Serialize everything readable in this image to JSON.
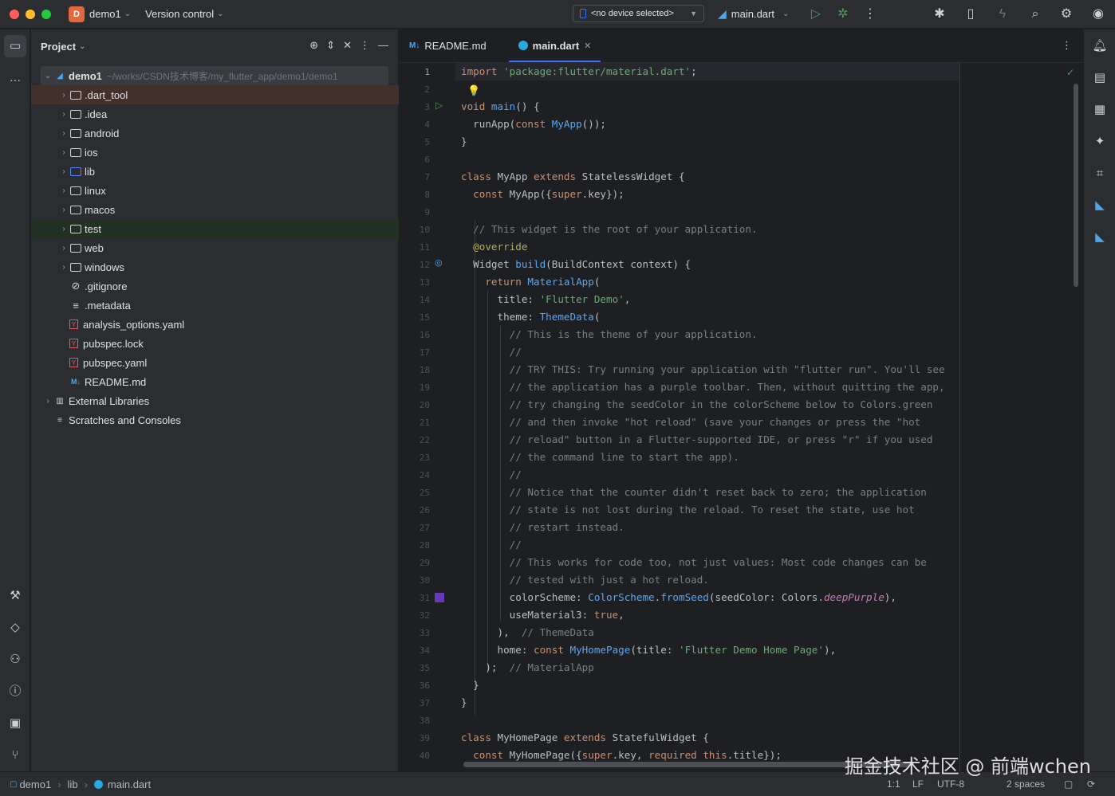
{
  "titlebar": {
    "project_badge": "D",
    "project_name": "demo1",
    "vcs": "Version control",
    "device": "<no device selected>",
    "run_config": "main.dart"
  },
  "project_panel": {
    "title": "Project",
    "root": {
      "name": "demo1",
      "path": "~/works/CSDN技术博客/my_flutter_app/demo1/demo1"
    },
    "items": [
      {
        "name": ".dart_tool",
        "kind": "folder",
        "expandable": true
      },
      {
        "name": ".idea",
        "kind": "folder",
        "expandable": true
      },
      {
        "name": "android",
        "kind": "folder",
        "expandable": true
      },
      {
        "name": "ios",
        "kind": "folder",
        "expandable": true
      },
      {
        "name": "lib",
        "kind": "folder",
        "expandable": true
      },
      {
        "name": "linux",
        "kind": "folder",
        "expandable": true
      },
      {
        "name": "macos",
        "kind": "folder",
        "expandable": true
      },
      {
        "name": "test",
        "kind": "folder",
        "expandable": true
      },
      {
        "name": "web",
        "kind": "folder",
        "expandable": true
      },
      {
        "name": "windows",
        "kind": "folder",
        "expandable": true
      },
      {
        "name": ".gitignore",
        "kind": "file",
        "expandable": false
      },
      {
        "name": ".metadata",
        "kind": "file",
        "expandable": false
      },
      {
        "name": "analysis_options.yaml",
        "kind": "yaml",
        "expandable": false
      },
      {
        "name": "pubspec.lock",
        "kind": "yaml",
        "expandable": false
      },
      {
        "name": "pubspec.yaml",
        "kind": "yaml",
        "expandable": false
      },
      {
        "name": "README.md",
        "kind": "md",
        "expandable": false
      }
    ],
    "external_libraries": "External Libraries",
    "scratches": "Scratches and Consoles"
  },
  "tabs": [
    {
      "label": "README.md",
      "icon": "M↓",
      "active": false
    },
    {
      "label": "main.dart",
      "icon": "dart",
      "active": true
    }
  ],
  "code_lines": [
    [
      [
        "kw",
        "import "
      ],
      [
        "str",
        "'package:flutter/material.dart'"
      ],
      [
        "df",
        ";"
      ]
    ],
    [],
    [
      [
        "kw",
        "void "
      ],
      [
        "fn",
        "main"
      ],
      [
        "df",
        "() {"
      ]
    ],
    [
      [
        "df",
        "  runApp("
      ],
      [
        "kw",
        "const "
      ],
      [
        "cls",
        "MyApp"
      ],
      [
        "df",
        "());"
      ]
    ],
    [
      [
        "df",
        "}"
      ]
    ],
    [],
    [
      [
        "kw",
        "class "
      ],
      [
        "df",
        "MyApp "
      ],
      [
        "kw",
        "extends "
      ],
      [
        "df",
        "StatelessWidget {"
      ]
    ],
    [
      [
        "df",
        "  "
      ],
      [
        "kw",
        "const "
      ],
      [
        "df",
        "MyApp({"
      ],
      [
        "kw",
        "super"
      ],
      [
        "df",
        ".key});"
      ]
    ],
    [],
    [
      [
        "cm",
        "  // This widget is the root of your application."
      ]
    ],
    [
      [
        "ann",
        "  @override"
      ]
    ],
    [
      [
        "df",
        "  Widget "
      ],
      [
        "fn",
        "build"
      ],
      [
        "df",
        "(BuildContext context) {"
      ]
    ],
    [
      [
        "kw",
        "    return "
      ],
      [
        "cls",
        "MaterialApp"
      ],
      [
        "df",
        "("
      ]
    ],
    [
      [
        "df",
        "      title: "
      ],
      [
        "str",
        "'Flutter Demo'"
      ],
      [
        "df",
        ","
      ]
    ],
    [
      [
        "df",
        "      theme: "
      ],
      [
        "cls",
        "ThemeData"
      ],
      [
        "df",
        "("
      ]
    ],
    [
      [
        "cm",
        "        // This is the theme of your application."
      ]
    ],
    [
      [
        "cm",
        "        //"
      ]
    ],
    [
      [
        "cm",
        "        // TRY THIS: Try running your application with \"flutter run\". You'll see"
      ]
    ],
    [
      [
        "cm",
        "        // the application has a purple toolbar. Then, without quitting the app,"
      ]
    ],
    [
      [
        "cm",
        "        // try changing the seedColor in the colorScheme below to Colors.green"
      ]
    ],
    [
      [
        "cm",
        "        // and then invoke \"hot reload\" (save your changes or press the \"hot"
      ]
    ],
    [
      [
        "cm",
        "        // reload\" button in a Flutter-supported IDE, or press \"r\" if you used"
      ]
    ],
    [
      [
        "cm",
        "        // the command line to start the app)."
      ]
    ],
    [
      [
        "cm",
        "        //"
      ]
    ],
    [
      [
        "cm",
        "        // Notice that the counter didn't reset back to zero; the application"
      ]
    ],
    [
      [
        "cm",
        "        // state is not lost during the reload. To reset the state, use hot"
      ]
    ],
    [
      [
        "cm",
        "        // restart instead."
      ]
    ],
    [
      [
        "cm",
        "        //"
      ]
    ],
    [
      [
        "cm",
        "        // This works for code too, not just values: Most code changes can be"
      ]
    ],
    [
      [
        "cm",
        "        // tested with just a hot reload."
      ]
    ],
    [
      [
        "df",
        "        colorScheme: "
      ],
      [
        "cls",
        "ColorScheme"
      ],
      [
        "df",
        "."
      ],
      [
        "fn",
        "fromSeed"
      ],
      [
        "df",
        "(seedColor: Colors."
      ],
      [
        "it",
        "deepPurple"
      ],
      [
        "df",
        "),"
      ]
    ],
    [
      [
        "df",
        "        useMaterial3: "
      ],
      [
        "kw",
        "true"
      ],
      [
        "df",
        ","
      ]
    ],
    [
      [
        "df",
        "      ),  "
      ],
      [
        "cm",
        "// ThemeData"
      ]
    ],
    [
      [
        "df",
        "      home: "
      ],
      [
        "kw",
        "const "
      ],
      [
        "cls",
        "MyHomePage"
      ],
      [
        "df",
        "(title: "
      ],
      [
        "str",
        "'Flutter Demo Home Page'"
      ],
      [
        "df",
        "),"
      ]
    ],
    [
      [
        "df",
        "    );  "
      ],
      [
        "cm",
        "// MaterialApp"
      ]
    ],
    [
      [
        "df",
        "  }"
      ]
    ],
    [
      [
        "df",
        "}"
      ]
    ],
    [],
    [
      [
        "kw",
        "class "
      ],
      [
        "df",
        "MyHomePage "
      ],
      [
        "kw",
        "extends "
      ],
      [
        "df",
        "StatefulWidget {"
      ]
    ],
    [
      [
        "df",
        "  "
      ],
      [
        "kw",
        "const "
      ],
      [
        "df",
        "MyHomePage({"
      ],
      [
        "kw",
        "super"
      ],
      [
        "df",
        ".key, "
      ],
      [
        "kw",
        "required this"
      ],
      [
        "df",
        ".title});"
      ]
    ]
  ],
  "status": {
    "crumb_project": "demo1",
    "crumb_folder": "lib",
    "crumb_file": "main.dart",
    "position": "1:1",
    "line_sep": "LF",
    "encoding": "UTF-8",
    "indent": "2 spaces"
  },
  "watermark": "掘金技术社区 @ 前端wchen",
  "colors": {
    "accent": "#3574f0",
    "bg": "#1e1f22",
    "panel": "#2b2d30",
    "selected_row": "#43302a",
    "test_row": "#233125"
  }
}
